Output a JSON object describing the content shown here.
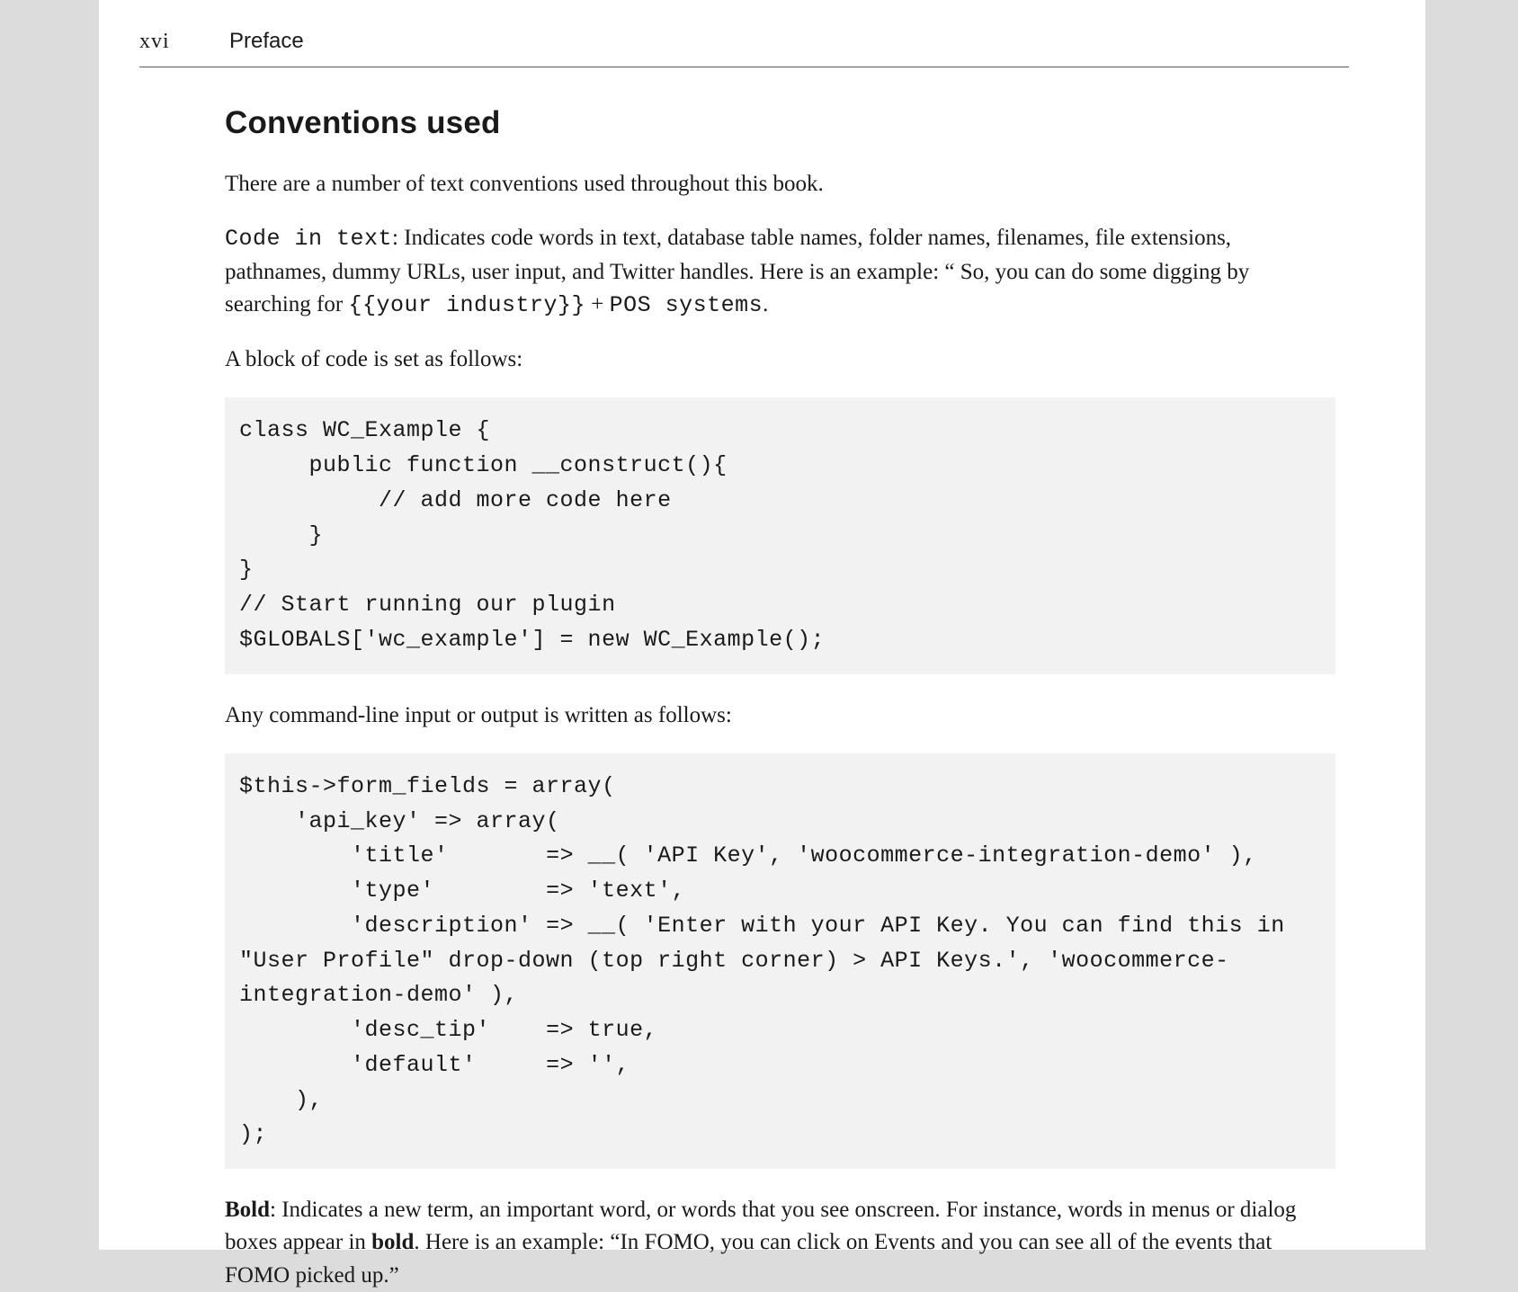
{
  "header": {
    "page_number": "xvi",
    "section_label": "Preface"
  },
  "heading": "Conventions used",
  "intro": "There are a number of text conventions used throughout this book.",
  "code_in_text": {
    "label": "Code in text",
    "desc_before": ": Indicates code words in text, database table names, folder names, filenames, file extensions, pathnames, dummy URLs, user input, and Twitter handles. Here is an example: “ So, you can do some digging by searching for ",
    "inline1": "{{your industry}}",
    "plus": " + ",
    "inline2": "POS systems",
    "desc_after": "."
  },
  "block_intro": "A block of code is set as follows:",
  "code_block_1": "class WC_Example {\n     public function __construct(){\n          // add more code here\n     }\n}\n// Start running our plugin\n$GLOBALS['wc_example'] = new WC_Example();",
  "cli_intro": "Any command-line input or output is written as follows:",
  "code_block_2": "$this->form_fields = array(\n    'api_key' => array(\n        'title'       => __( 'API Key', 'woocommerce-integration-demo' ),\n        'type'        => 'text',\n        'description' => __( 'Enter with your API Key. You can find this in \"User Profile\" drop-down (top right corner) > API Keys.', 'woocommerce-integration-demo' ),\n        'desc_tip'    => true,\n        'default'     => '',\n    ),\n);",
  "bold_section": {
    "label": "Bold",
    "desc1": ": Indicates a new term, an important word, or words that you see onscreen. For instance, words in menus or dialog boxes appear in ",
    "bold_word": "bold",
    "desc2": ". Here is an example: “In FOMO, you can click on Events and you can see all of the events that FOMO picked up.”"
  }
}
